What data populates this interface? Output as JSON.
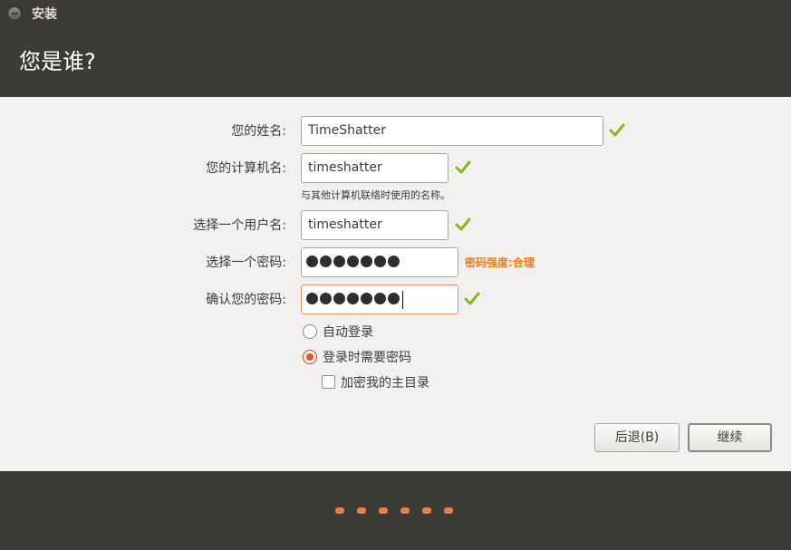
{
  "window": {
    "title": "安装"
  },
  "header": {
    "title": "您是谁?"
  },
  "form": {
    "name_label": "您的姓名:",
    "name_value": "TimeShatter",
    "computer_label": "您的计算机名:",
    "computer_value": "timeshatter",
    "computer_hint": "与其他计算机联络时使用的名称。",
    "username_label": "选择一个用户名:",
    "username_value": "timeshatter",
    "password_label": "选择一个密码:",
    "password_length": 7,
    "password_strength": "密码强度:合理",
    "confirm_label": "确认您的密码:",
    "confirm_length": 7
  },
  "options": {
    "auto_login": {
      "label": "自动登录",
      "selected": false
    },
    "require_password": {
      "label": "登录时需要密码",
      "selected": true
    },
    "encrypt_home": {
      "label": "加密我的主目录",
      "checked": false
    }
  },
  "buttons": {
    "back": "后退(B)",
    "continue": "继续"
  },
  "progress": {
    "total_steps": 6
  },
  "colors": {
    "accent": "#e95420",
    "check": "#8cb51f",
    "strength": "#f07d16",
    "panel": "#3c3b37"
  },
  "icons": [
    "close-icon",
    "check-icon"
  ]
}
